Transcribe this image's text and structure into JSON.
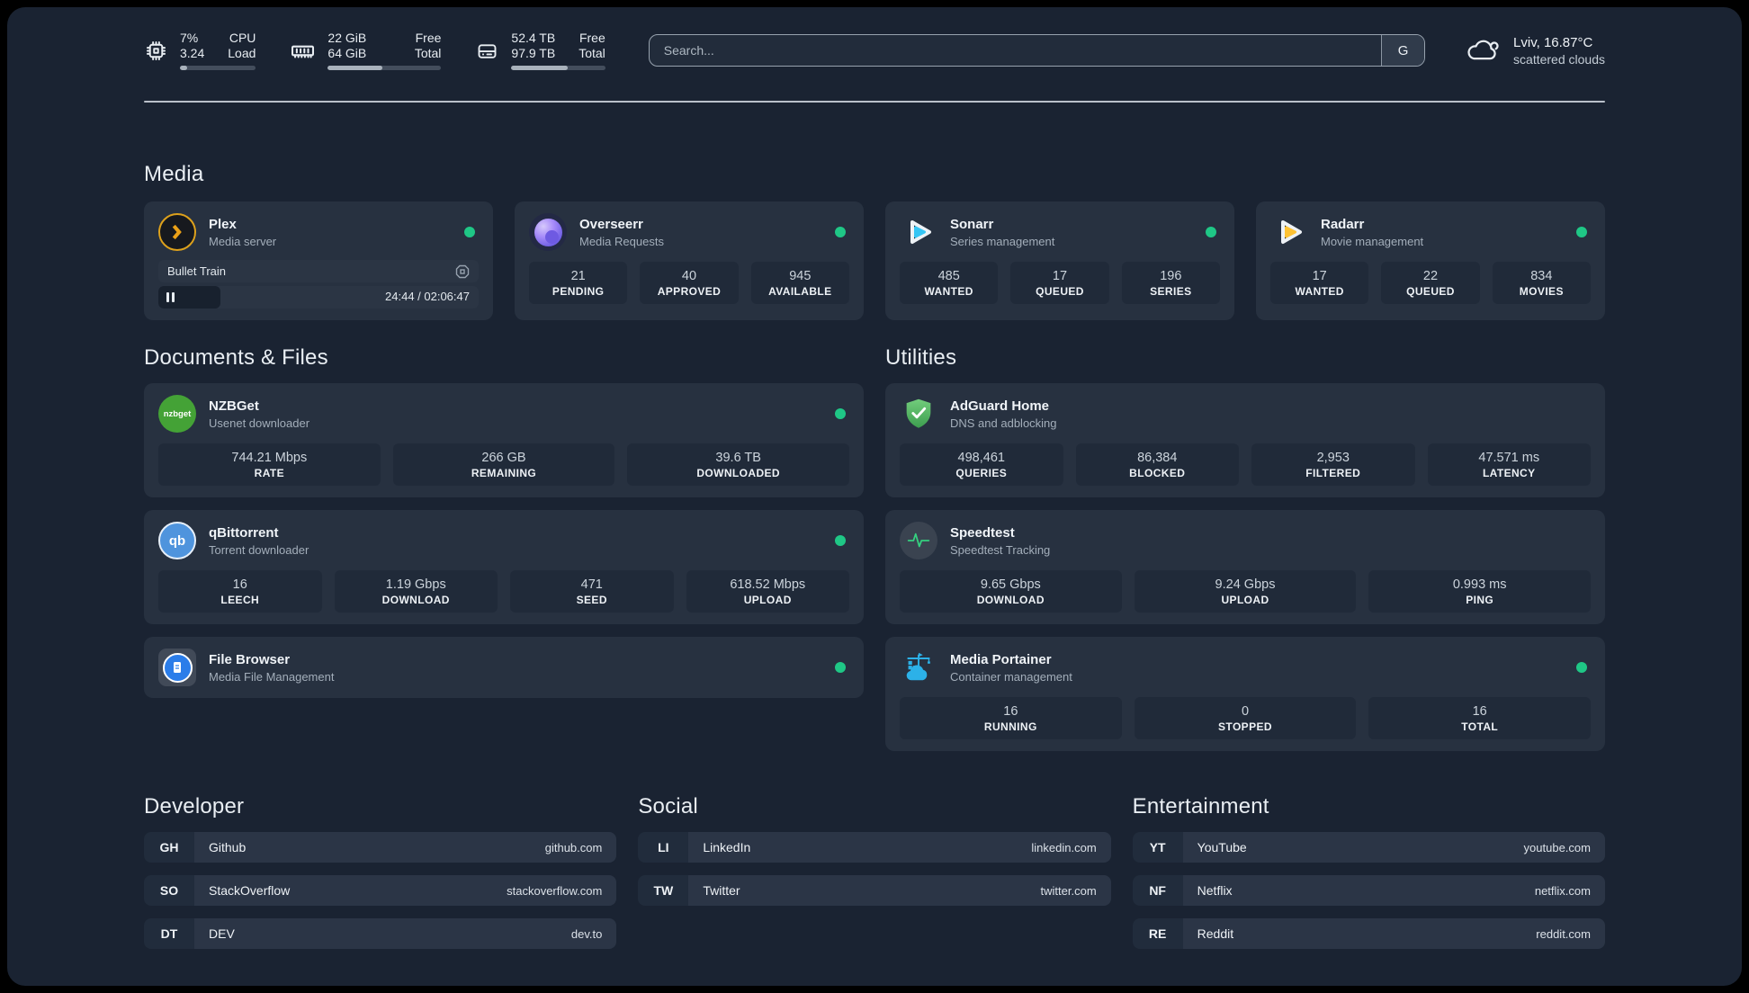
{
  "header": {
    "system_stats": [
      {
        "value_top": "7%",
        "value_bottom": "3.24",
        "label_top": "CPU",
        "label_bottom": "Load",
        "progress_pct": 10
      },
      {
        "value_top": "22 GiB",
        "value_bottom": "64 GiB",
        "label_top": "Free",
        "label_bottom": "Total",
        "progress_pct": 48
      },
      {
        "value_top": "52.4 TB",
        "value_bottom": "97.9 TB",
        "label_top": "Free",
        "label_bottom": "Total",
        "progress_pct": 60
      }
    ],
    "search": {
      "placeholder": "Search...",
      "engine_label": "G"
    },
    "weather": {
      "title": "Lviv, 16.87°C",
      "subtitle": "scattered clouds"
    }
  },
  "media": {
    "title": "Media",
    "plex": {
      "name": "Plex",
      "desc": "Media server",
      "now_playing": {
        "title": "Bullet Train",
        "time": "24:44 / 02:06:47",
        "progress_pct": 19.5
      }
    },
    "overseerr": {
      "name": "Overseerr",
      "desc": "Media Requests",
      "stats": [
        {
          "value": "21",
          "label": "PENDING"
        },
        {
          "value": "40",
          "label": "APPROVED"
        },
        {
          "value": "945",
          "label": "AVAILABLE"
        }
      ]
    },
    "sonarr": {
      "name": "Sonarr",
      "desc": "Series management",
      "stats": [
        {
          "value": "485",
          "label": "WANTED"
        },
        {
          "value": "17",
          "label": "QUEUED"
        },
        {
          "value": "196",
          "label": "SERIES"
        }
      ]
    },
    "radarr": {
      "name": "Radarr",
      "desc": "Movie management",
      "stats": [
        {
          "value": "17",
          "label": "WANTED"
        },
        {
          "value": "22",
          "label": "QUEUED"
        },
        {
          "value": "834",
          "label": "MOVIES"
        }
      ]
    }
  },
  "documents": {
    "title": "Documents & Files",
    "nzbget": {
      "name": "NZBGet",
      "desc": "Usenet downloader",
      "icon_text": "nzbget",
      "stats": [
        {
          "value": "744.21 Mbps",
          "label": "RATE"
        },
        {
          "value": "266 GB",
          "label": "REMAINING"
        },
        {
          "value": "39.6 TB",
          "label": "DOWNLOADED"
        }
      ]
    },
    "qbittorrent": {
      "name": "qBittorrent",
      "desc": "Torrent downloader",
      "icon_text": "qb",
      "stats": [
        {
          "value": "16",
          "label": "LEECH"
        },
        {
          "value": "1.19 Gbps",
          "label": "DOWNLOAD"
        },
        {
          "value": "471",
          "label": "SEED"
        },
        {
          "value": "618.52 Mbps",
          "label": "UPLOAD"
        }
      ]
    },
    "filebrowser": {
      "name": "File Browser",
      "desc": "Media File Management"
    }
  },
  "utilities": {
    "title": "Utilities",
    "adguard": {
      "name": "AdGuard Home",
      "desc": "DNS and adblocking",
      "stats": [
        {
          "value": "498,461",
          "label": "QUERIES"
        },
        {
          "value": "86,384",
          "label": "BLOCKED"
        },
        {
          "value": "2,953",
          "label": "FILTERED"
        },
        {
          "value": "47.571 ms",
          "label": "LATENCY"
        }
      ]
    },
    "speedtest": {
      "name": "Speedtest",
      "desc": "Speedtest Tracking",
      "stats": [
        {
          "value": "9.65 Gbps",
          "label": "DOWNLOAD"
        },
        {
          "value": "9.24 Gbps",
          "label": "UPLOAD"
        },
        {
          "value": "0.993 ms",
          "label": "PING"
        }
      ]
    },
    "portainer": {
      "name": "Media Portainer",
      "desc": "Container management",
      "stats": [
        {
          "value": "16",
          "label": "RUNNING"
        },
        {
          "value": "0",
          "label": "STOPPED"
        },
        {
          "value": "16",
          "label": "TOTAL"
        }
      ]
    }
  },
  "links": {
    "developer": {
      "title": "Developer",
      "items": [
        {
          "abbr": "GH",
          "name": "Github",
          "url": "github.com"
        },
        {
          "abbr": "SO",
          "name": "StackOverflow",
          "url": "stackoverflow.com"
        },
        {
          "abbr": "DT",
          "name": "DEV",
          "url": "dev.to"
        }
      ]
    },
    "social": {
      "title": "Social",
      "items": [
        {
          "abbr": "LI",
          "name": "LinkedIn",
          "url": "linkedin.com"
        },
        {
          "abbr": "TW",
          "name": "Twitter",
          "url": "twitter.com"
        }
      ]
    },
    "entertainment": {
      "title": "Entertainment",
      "items": [
        {
          "abbr": "YT",
          "name": "YouTube",
          "url": "youtube.com"
        },
        {
          "abbr": "NF",
          "name": "Netflix",
          "url": "netflix.com"
        },
        {
          "abbr": "RE",
          "name": "Reddit",
          "url": "reddit.com"
        }
      ]
    }
  },
  "colors": {
    "background": "#1a2332",
    "card": "#273140",
    "status_online": "#1fc786",
    "plex_amber": "#e5a00d",
    "sonarr_blue": "#35c5f4",
    "radarr_amber": "#ffc230",
    "adguard_green": "#55b863",
    "portainer_blue": "#2cb1e8",
    "speedtest_green": "#35d07f"
  }
}
